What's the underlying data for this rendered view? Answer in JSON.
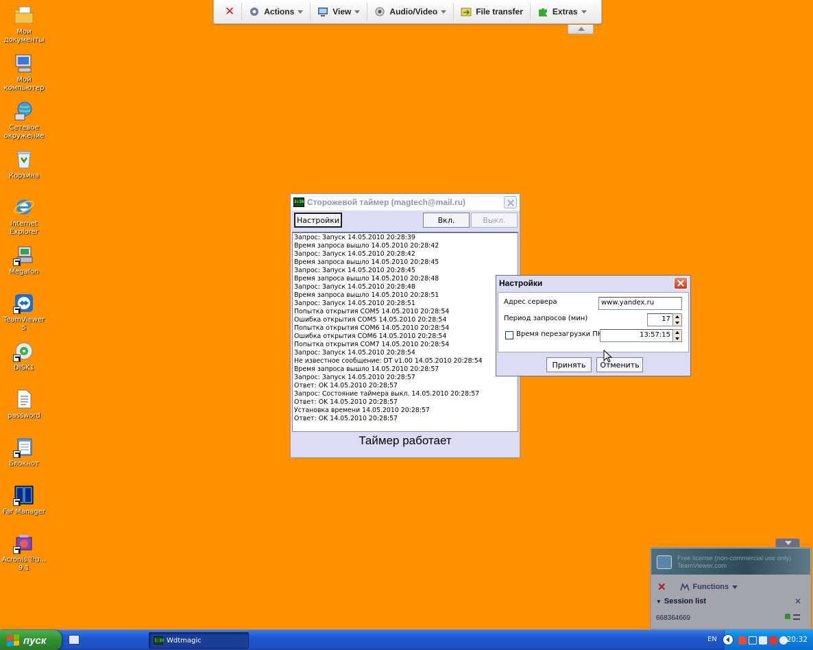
{
  "desktop": {
    "icons": [
      {
        "label": "Мои документы",
        "icon": "my-documents-icon"
      },
      {
        "label": "Мой компьютер",
        "icon": "my-computer-icon"
      },
      {
        "label": "Сетевое окружение",
        "icon": "network-places-icon"
      },
      {
        "label": "Корзина",
        "icon": "recycle-bin-icon"
      },
      {
        "label": "Internet Explorer",
        "icon": "internet-explorer-icon"
      },
      {
        "label": "Megafon",
        "icon": "megafon-icon"
      },
      {
        "label": "TeamViewer 5",
        "icon": "teamviewer-icon"
      },
      {
        "label": "DISK1",
        "icon": "disk-icon"
      },
      {
        "label": "password",
        "icon": "text-file-icon"
      },
      {
        "label": "Блокнот",
        "icon": "notepad-icon"
      },
      {
        "label": "Far Manager",
        "icon": "far-manager-icon"
      },
      {
        "label": "Acronis Tru... 9.1",
        "icon": "acronis-icon"
      }
    ]
  },
  "tv_toolbar": {
    "actions": "Actions",
    "view": "View",
    "audio_video": "Audio/Video",
    "file_transfer": "File transfer",
    "extras": "Extras"
  },
  "main_window": {
    "title": "Сторожевой таймер (magtech@mail.ru)",
    "app_icon_text": "3:30",
    "settings_button": "Настройки",
    "on_button": "Вкл.",
    "off_button": "Выкл.",
    "log": [
      "Запрос: Запуск 14.05.2010 20:28:39",
      "Время запроса вышло 14.05.2010 20:28:42",
      "Запрос: Запуск 14.05.2010 20:28:42",
      "Время запроса вышло 14.05.2010 20:28:45",
      "Запрос: Запуск 14.05.2010 20:28:45",
      "Время запроса вышло 14.05.2010 20:28:48",
      "Запрос: Запуск 14.05.2010 20:28:48",
      "Время запроса вышло 14.05.2010 20:28:51",
      "Запрос: Запуск 14.05.2010 20:28:51",
      "Попытка открытия COM5 14.05.2010 20:28:54",
      "Ошибка открытия COM5 14.05.2010 20:28:54",
      "Попытка открытия COM6 14.05.2010 20:28:54",
      "Ошибка открытия COM6 14.05.2010 20:28:54",
      "Попытка открытия COM7 14.05.2010 20:28:54",
      "Запрос: Запуск 14.05.2010 20:28:54",
      "Не известное сообщение: DT v1.00 14.05.2010 20:28:54",
      "Время запроса вышло 14.05.2010 20:28:57",
      "Запрос: Запуск 14.05.2010 20:28:57",
      "Ответ: OK 14.05.2010 20:28:57",
      "Запрос: Состояние таймера выкл. 14.05.2010 20:28:57",
      "Ответ: OK 14.05.2010 20:28:57",
      "Установка времени 14.05.2010 20:28:57",
      "Ответ: OK 14.05.2010 20:28:57"
    ],
    "status": "Таймер работает"
  },
  "settings_dialog": {
    "title": "Настройки",
    "server_label": "Адрес сервера",
    "server_value": "www.yandex.ru",
    "period_label": "Период запросов (мин)",
    "period_value": "17",
    "reboot_label": "Время перезагрузки ПК",
    "reboot_checked": false,
    "reboot_value": "13:57:15",
    "accept_button": "Принять",
    "cancel_button": "Отменить"
  },
  "tv_panel": {
    "banner_line1": "Free license (non-commercial use only)",
    "banner_line2": "TeamViewer.com",
    "functions": "Functions",
    "session_list": "Session list",
    "session_id": "668364669"
  },
  "taskbar": {
    "start_label": "пуск",
    "task_label": "Wdtmagic",
    "task_icon_text": "3:30",
    "language": "EN",
    "clock": "20:32"
  },
  "colors": {
    "desktop_background": "#ff9000",
    "taskbar_blue": "#1f4fc0",
    "start_green": "#2f8f2f",
    "window_face": "#dcdcf5",
    "close_red": "#c6371a"
  }
}
